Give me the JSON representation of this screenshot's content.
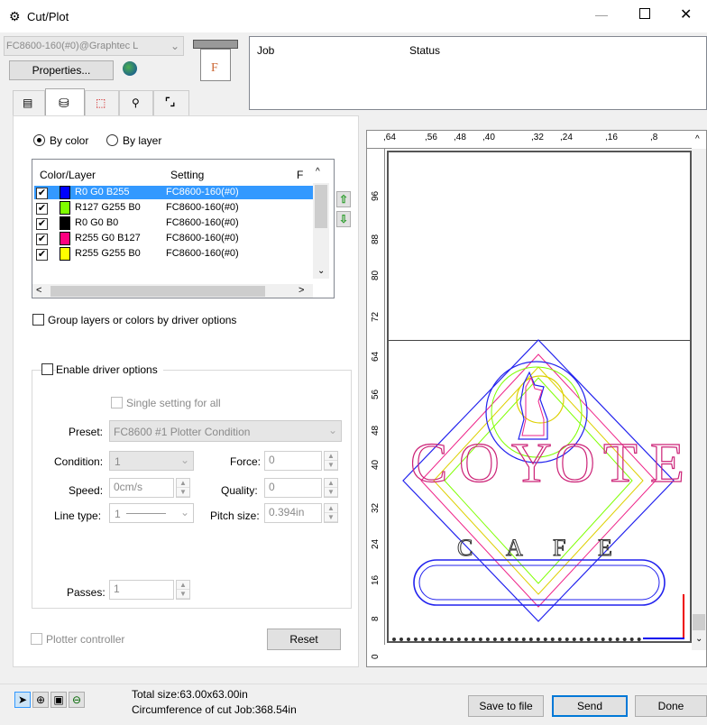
{
  "window": {
    "title": "Cut/Plot"
  },
  "device": {
    "selected": "FC8600-160(#0)@Graphtec L",
    "properties_label": "Properties..."
  },
  "jobs": {
    "headers": [
      "Job",
      "Status"
    ]
  },
  "mode": {
    "by_color": "By color",
    "by_layer": "By layer"
  },
  "layers": {
    "headers": [
      "Color/Layer",
      "Setting",
      "F"
    ],
    "rows": [
      {
        "name": "R0 G0 B255",
        "setting": "FC8600-160(#0)",
        "color": "#0000ff",
        "checked": true,
        "selected": true
      },
      {
        "name": "R127 G255 B0",
        "setting": "FC8600-160(#0)",
        "color": "#7fff00",
        "checked": true
      },
      {
        "name": "R0 G0 B0",
        "setting": "FC8600-160(#0)",
        "color": "#000000",
        "checked": true
      },
      {
        "name": "R255 G0 B127",
        "setting": "FC8600-160(#0)",
        "color": "#ff007f",
        "checked": true
      },
      {
        "name": "R255 G255 B0",
        "setting": "FC8600-160(#0)",
        "color": "#ffff00",
        "checked": true
      }
    ]
  },
  "group_label": "Group layers or colors by driver options",
  "driver": {
    "enable_label": "Enable driver options",
    "single_setting": "Single setting for all",
    "preset_label": "Preset:",
    "preset_value": "FC8600 #1 Plotter Condition",
    "condition_label": "Condition:",
    "condition_value": "1",
    "force_label": "Force:",
    "force_value": "0",
    "speed_label": "Speed:",
    "speed_value": "0cm/s",
    "quality_label": "Quality:",
    "quality_value": "0",
    "linetype_label": "Line type:",
    "linetype_value": "1",
    "pitch_label": "Pitch size:",
    "pitch_value": "0.394in",
    "passes_label": "Passes:",
    "passes_value": "1"
  },
  "plotter_controller": "Plotter controller",
  "reset_label": "Reset",
  "ruler": {
    "top": [
      ",64",
      ",56",
      ",48",
      ",40",
      ",32",
      ",24",
      ",16",
      ",8"
    ],
    "left": [
      "96",
      "88",
      "80",
      "72",
      "64",
      "56",
      "48",
      "40",
      "32",
      "24",
      "16",
      "8",
      "0"
    ]
  },
  "preview": {
    "letters_top": [
      "C",
      "O",
      "Y",
      "O",
      "T",
      "E"
    ],
    "letters_bottom": [
      "C",
      "A",
      "F",
      "E"
    ]
  },
  "footer": {
    "total_size": "Total size:63.00x63.00in",
    "circumference": "Circumference of cut Job:368.54in",
    "save_label": "Save to file",
    "send_label": "Send",
    "done_label": "Done"
  },
  "colors": {
    "accent": "#3399ff",
    "send_border": "#0078d7"
  },
  "icons": [
    "cut-plot-icon",
    "minimize-icon",
    "maximize-icon",
    "close-icon",
    "general-tab-icon",
    "layers-tab-icon",
    "tiling-tab-icon",
    "tool-tab-icon",
    "frame-tab-icon",
    "move-up-icon",
    "move-down-icon",
    "pointer-icon",
    "zoom-icon",
    "fit-icon",
    "zoom-out-icon"
  ]
}
